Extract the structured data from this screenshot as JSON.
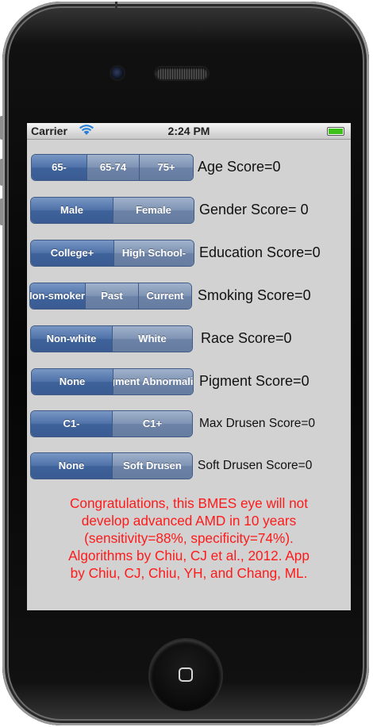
{
  "status_bar": {
    "carrier": "Carrier",
    "time": "2:24 PM"
  },
  "accent_colors": {
    "selected_segment": "#3e629b",
    "unselected_segment": "#7e93b4",
    "message": "#ff1a1a",
    "battery": "#3ec11b"
  },
  "rows": [
    {
      "options": [
        "65-",
        "65-74",
        "75+"
      ],
      "selected": 0,
      "score": "Age Score=0"
    },
    {
      "options": [
        "Male",
        "Female"
      ],
      "selected": 0,
      "score": "Gender Score= 0"
    },
    {
      "options": [
        "College+",
        "High School-"
      ],
      "selected": 0,
      "score": "Education Score=0"
    },
    {
      "options": [
        "Non-smoker",
        "Past",
        "Current"
      ],
      "selected": 0,
      "score": "Smoking Score=0"
    },
    {
      "options": [
        "Non-white",
        "White"
      ],
      "selected": 0,
      "score": "Race Score=0"
    },
    {
      "options": [
        "None",
        "Pigment Abnormality"
      ],
      "selected": 0,
      "score": "Pigment Score=0"
    },
    {
      "options": [
        "C1-",
        "C1+"
      ],
      "selected": 0,
      "score": "Max Drusen Score=0"
    },
    {
      "options": [
        "None",
        "Soft Drusen"
      ],
      "selected": 0,
      "score": "Soft Drusen Score=0"
    }
  ],
  "result_message": {
    "line1": "Congratulations, this BMES eye will not",
    "line2": "develop advanced AMD in 10 years",
    "line3": "(sensitivity=88%, specificity=74%).",
    "line4": "Algorithms by Chiu, CJ et al., 2012. App",
    "line5": "by Chiu, CJ, Chiu, YH, and Chang, ML."
  }
}
